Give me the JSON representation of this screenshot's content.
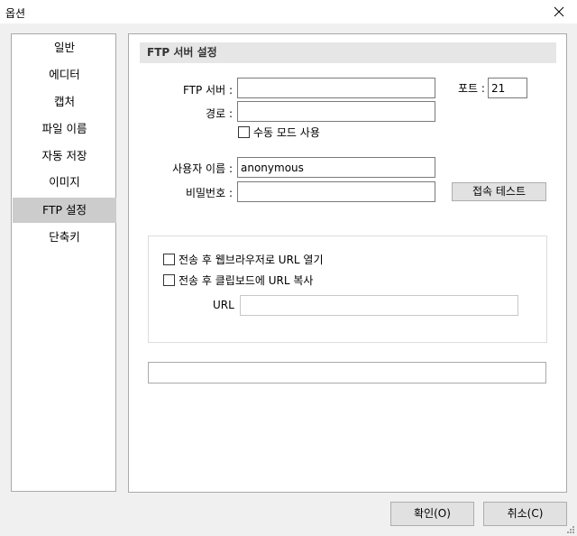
{
  "window": {
    "title": "옵션"
  },
  "sidebar": {
    "items": [
      {
        "label": "일반"
      },
      {
        "label": "에디터"
      },
      {
        "label": "캡처"
      },
      {
        "label": "파일 이름"
      },
      {
        "label": "자동 저장"
      },
      {
        "label": "이미지"
      },
      {
        "label": "FTP 설정",
        "selected": true
      },
      {
        "label": "단축키"
      }
    ]
  },
  "ftp": {
    "section_title": "FTP 서버 설정",
    "server_label": "FTP 서버 :",
    "server_value": "",
    "port_label": "포트 :",
    "port_value": "21",
    "path_label": "경로 :",
    "path_value": "",
    "passive_label": "수동 모드 사용",
    "user_label": "사용자 이름 :",
    "user_value": "anonymous",
    "password_label": "비밀번호 :",
    "password_value": "",
    "test_button": "접속 테스트",
    "open_browser_label": "전송 후 웹브라우저로 URL 열기",
    "copy_clipboard_label": "전송 후 클립보드에 URL 복사",
    "url_label": "URL",
    "url_value": "",
    "status_text": ""
  },
  "footer": {
    "ok_button": "확인(O)",
    "cancel_button": "취소(C)"
  },
  "icons": {
    "close": "close-icon",
    "resize_grip": "resize-grip-icon"
  },
  "colors": {
    "selected_nav_bg": "#cccccc",
    "section_header_bg": "#e6e6e6",
    "button_bg": "#e1e1e1"
  }
}
